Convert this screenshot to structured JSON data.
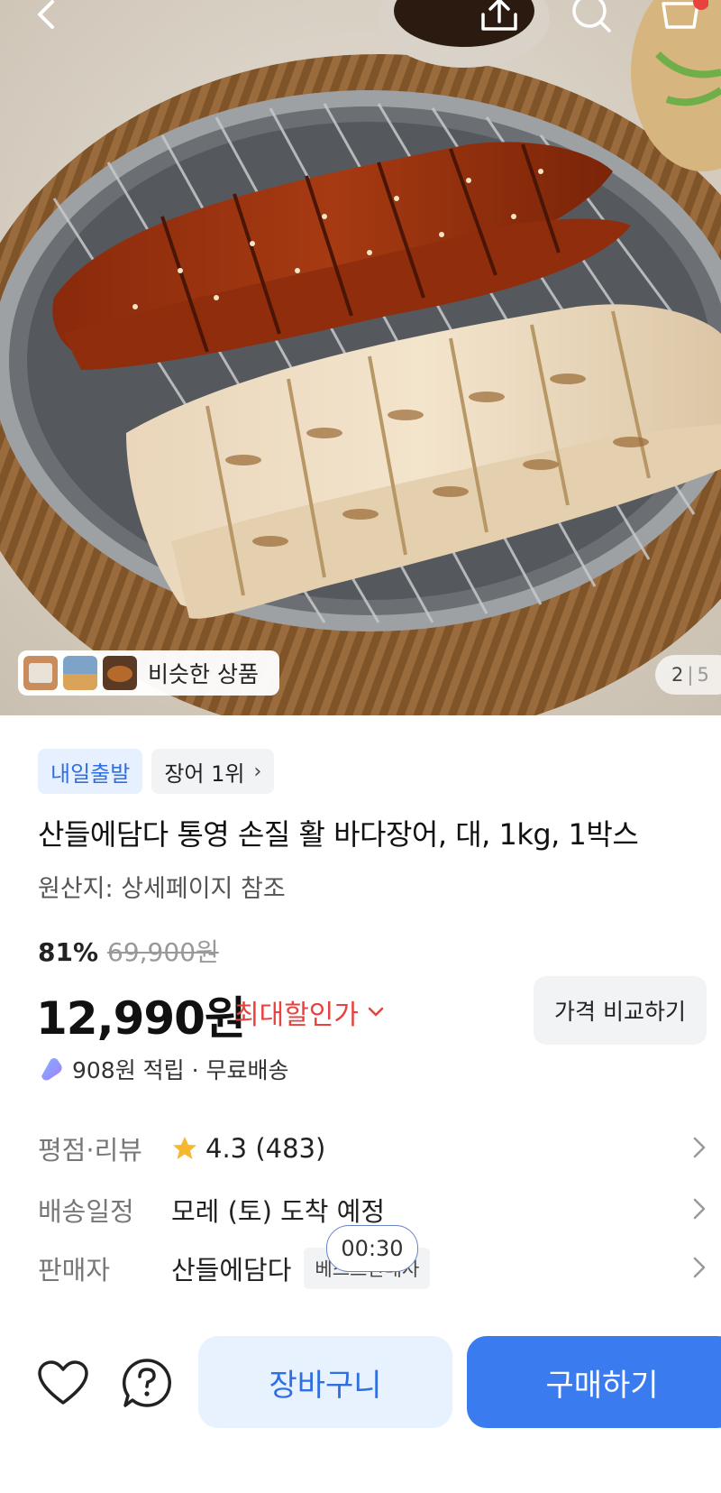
{
  "hero": {
    "similar_label": "비슷한 상품",
    "counter_current": "2",
    "counter_total": "5",
    "cart_badge_count": "",
    "icons": [
      "back-icon",
      "share-icon",
      "search-icon",
      "cart-icon"
    ]
  },
  "product": {
    "badge_delivery": "내일출발",
    "badge_rank": "장어 1위",
    "title": "산들에담다 통영 손질 활 바다장어, 대, 1kg, 1박스",
    "origin": "원산지: 상세페이지 참조",
    "discount_pct": "81%",
    "original_price": "69,900원",
    "price": "12,990원",
    "max_discount_label": "최대할인가",
    "compare_label": "가격 비교하기",
    "points": "908원 적립 · 무료배송"
  },
  "info": {
    "rating_label": "평점·리뷰",
    "rating_value": "4.3 (483)",
    "shipping_label": "배송일정",
    "shipping_value": "모레 (토) 도착 예정",
    "seller_label": "판매자",
    "seller_value": "산들에담다",
    "seller_badge": "베스트판매자",
    "timer": "00:30"
  },
  "actions": {
    "cart_label": "장바구니",
    "buy_label": "구매하기"
  },
  "colors": {
    "accent_blue": "#3a7cf0",
    "discount_red": "#e8423f",
    "star_yellow": "#f5b82e"
  }
}
